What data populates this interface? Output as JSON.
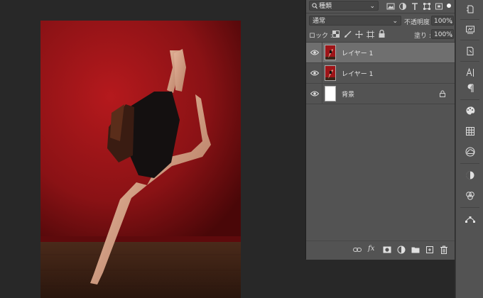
{
  "layers_panel": {
    "filter_kind": "種類",
    "blend_mode": "通常",
    "opacity_label": "不透明度 :",
    "opacity_value": "100%",
    "lock_label": "ロック :",
    "fill_label": "塗り :",
    "fill_value": "100%",
    "layers": [
      {
        "name": "レイヤー 1",
        "selected": true,
        "visible": true,
        "locked": false
      },
      {
        "name": "レイヤー 1",
        "selected": false,
        "visible": true,
        "locked": false
      },
      {
        "name": "背景",
        "selected": false,
        "visible": true,
        "locked": true
      }
    ],
    "footer_fx": "fx"
  },
  "colors": {
    "panel_bg": "#535353",
    "selected_row": "#6f6f6f",
    "canvas_bg": "#282828",
    "photo_wall_red": "#9e1418",
    "photo_floor": "#3b2418"
  },
  "icons": {
    "filter": "search-icon",
    "tools_strip": [
      "history-icon",
      "libraries-icon",
      "clone-source-icon",
      "character-icon",
      "paragraph-icon",
      "swatches-icon",
      "grid-icon",
      "creative-cloud-icon",
      "adjustments-icon",
      "channels-icon",
      "paths-icon"
    ],
    "footer": [
      "link-icon",
      "fx-icon",
      "mask-icon",
      "adjustment-layer-icon",
      "group-folder-icon",
      "new-layer-icon",
      "trash-icon"
    ]
  }
}
